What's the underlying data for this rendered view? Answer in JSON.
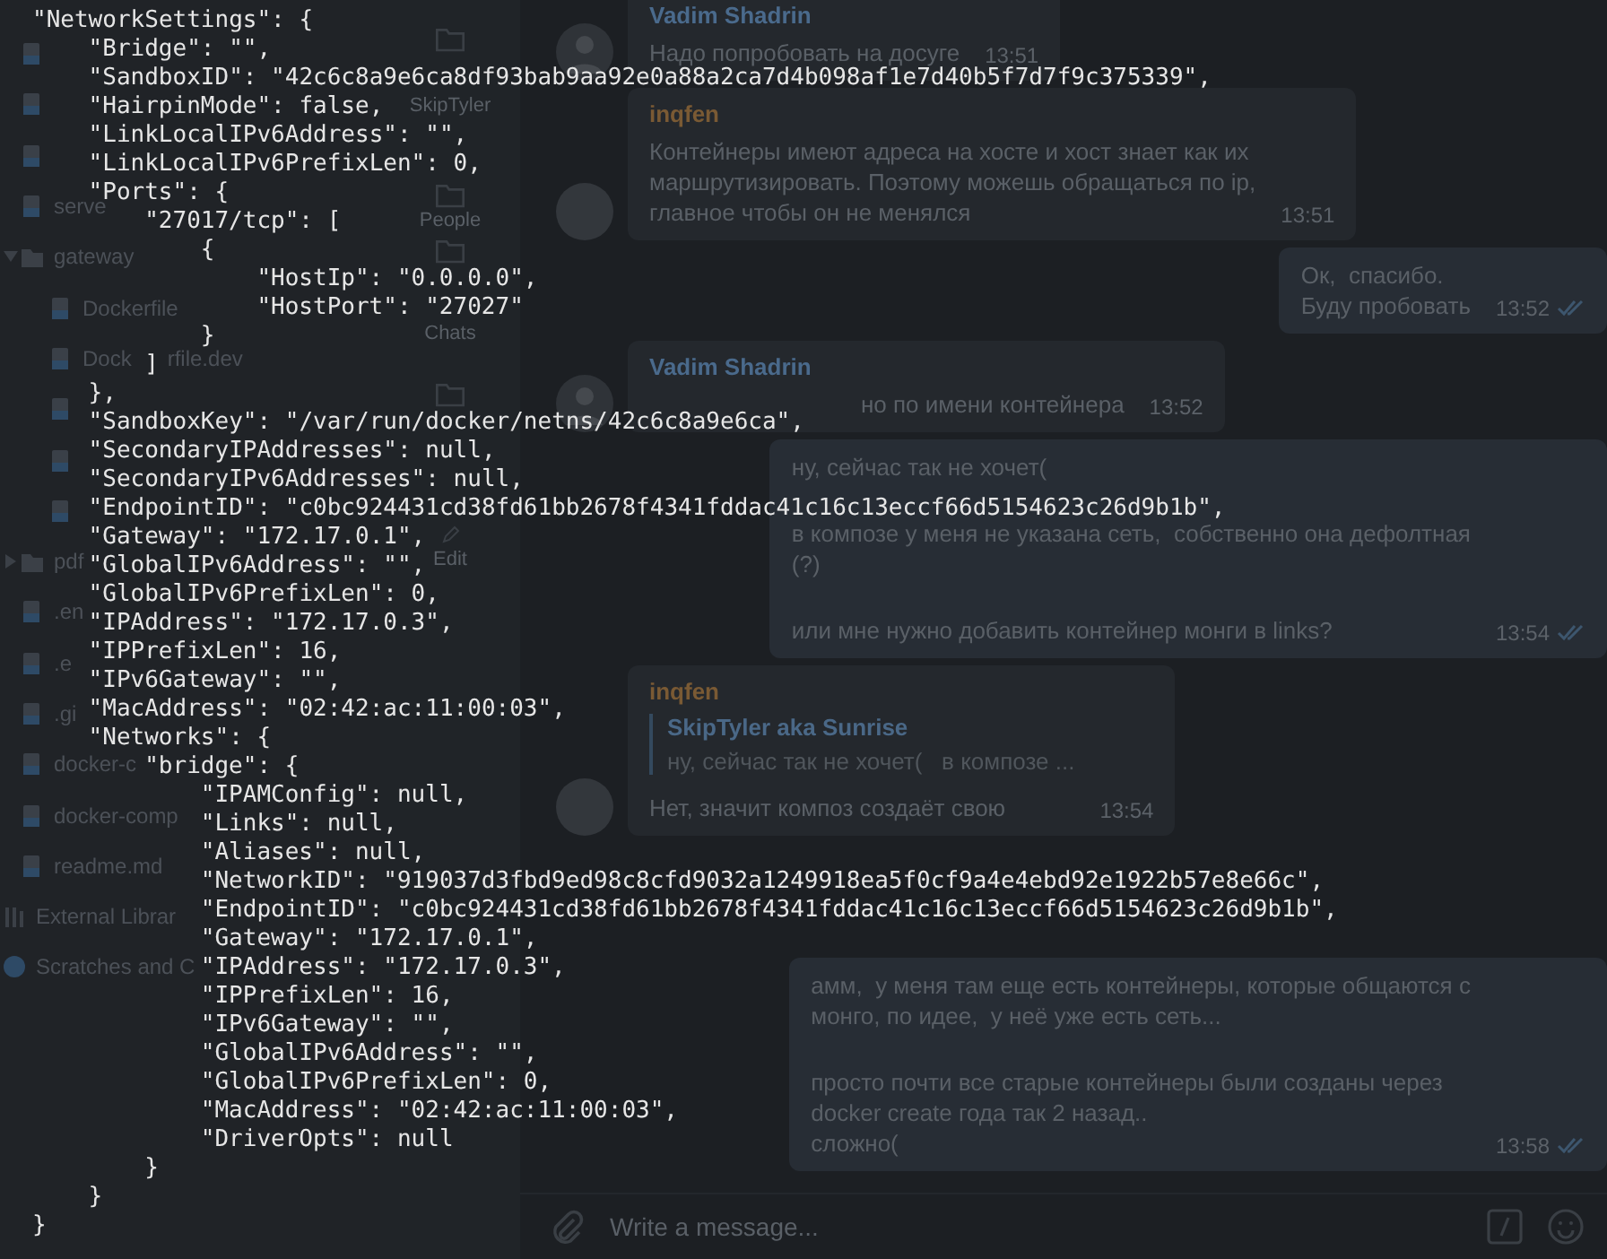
{
  "project_tree": {
    "items": [
      {
        "kind": "file"
      },
      {
        "kind": "file"
      },
      {
        "kind": "file"
      },
      {
        "kind": "file",
        "label": "serve"
      },
      {
        "kind": "folder",
        "label": "gateway",
        "expanded": true,
        "children": [
          {
            "kind": "file",
            "label": "Dockerfile"
          },
          {
            "kind": "file",
            "label_parts": [
              "Dock",
              "rfile.dev"
            ]
          },
          {
            "kind": "file"
          },
          {
            "kind": "file"
          },
          {
            "kind": "file"
          }
        ]
      },
      {
        "kind": "folder",
        "label": "pdf",
        "expanded": false
      },
      {
        "kind": "file",
        "label": ".en"
      },
      {
        "kind": "file",
        "label": ".e"
      },
      {
        "kind": "file",
        "label": ".gi"
      },
      {
        "kind": "file",
        "label": "docker-c"
      },
      {
        "kind": "file",
        "label": "docker-comp"
      },
      {
        "kind": "file",
        "label": "readme.md"
      },
      {
        "kind": "library",
        "label": "External Librar"
      },
      {
        "kind": "scratch",
        "label": "Scratches and C"
      }
    ]
  },
  "folders": [
    {
      "kind": "folder",
      "label": "SkipTyler"
    },
    {
      "kind": "folder",
      "label": "People"
    },
    {
      "kind": "folder",
      "label": "Chats"
    },
    {
      "kind": "folder"
    },
    {
      "kind": "edit",
      "label": "Edit"
    }
  ],
  "messages": [
    {
      "kind": "incoming",
      "sender": "Vadim Shadrin",
      "color": "#4a6a8c",
      "avatar": {
        "kind": "figure"
      },
      "paragraphs": [
        "Надо попробовать на досуге"
      ],
      "time": "13:51"
    },
    {
      "kind": "incoming",
      "sender": "inqfen",
      "color": "#7a5a34",
      "avatar": {
        "kind": "plain"
      },
      "paragraphs": [
        "Контейнеры имеют адреса на хосте и хост знает как их\nмаршрутизировать. Поэтому можешь обращаться по ip,\nглавное чтобы он не менялся"
      ],
      "time": "13:51"
    },
    {
      "kind": "outgoing",
      "paragraphs": [
        "Ок,  спасибо.\nБуду пробовать"
      ],
      "time": "13:52",
      "read": true
    },
    {
      "kind": "incoming",
      "sender": "Vadim Shadrin",
      "color": "#4a6a8c",
      "avatar": {
        "kind": "figure"
      },
      "paragraphs": [
        "но по имени контейнера"
      ],
      "time": "13:52"
    },
    {
      "kind": "outgoing",
      "paragraphs": [
        "ну, сейчас так не хочет(",
        "в композе у меня не указана сеть,  собственно она дефолтная\n(?)",
        "или мне нужно добавить контейнер монги в links?"
      ],
      "time": "13:54",
      "read": true
    },
    {
      "kind": "incoming",
      "sender": "inqfen",
      "color": "#7a5a34",
      "avatar": {
        "kind": "plain"
      },
      "reply": {
        "sender": "SkipTyler aka Sunrise",
        "text": "ну, сейчас так не хочет(   в композе ..."
      },
      "paragraphs": [
        "Нет, значит композ создаёт свою"
      ],
      "time": "13:54"
    },
    {
      "kind": "outgoing",
      "paragraphs": [
        "амм,  у меня там еще есть контейнеры, которые общаются с\nмонго, по идее,  у неё уже есть сеть...",
        "просто почти все старые контейнеры были созданы через\ndocker create года так 2 назад..\nсложно("
      ],
      "time": "13:58",
      "read": true
    }
  ],
  "composer": {
    "placeholder": "Write a message..."
  },
  "terminal": {
    "lines": [
      {
        "text": "\"NetworkSettings\": {",
        "close": "}",
        "children": [
          {
            "text": "\"Bridge\": \"\","
          },
          {
            "text": "\"SandboxID\": \"42c6c8a9e6ca8df93bab9aa92e0a88a2ca7d4b098af1e7d40b5f7d7f9c375339\","
          },
          {
            "text": "\"HairpinMode\": false,"
          },
          {
            "text": "\"LinkLocalIPv6Address\": \"\","
          },
          {
            "text": "\"LinkLocalIPv6PrefixLen\": 0,"
          },
          {
            "text": "\"Ports\": {",
            "close": "},",
            "children": [
              {
                "text": "\"27017/tcp\": [",
                "close": "]",
                "children": [
                  {
                    "text": "{",
                    "close": "}",
                    "children": [
                      {
                        "text": "\"HostIp\": \"0.0.0.0\","
                      },
                      {
                        "text": "\"HostPort\": \"27027\""
                      }
                    ]
                  }
                ]
              }
            ]
          },
          {
            "text": "\"SandboxKey\": \"/var/run/docker/netns/42c6c8a9e6ca\","
          },
          {
            "text": "\"SecondaryIPAddresses\": null,"
          },
          {
            "text": "\"SecondaryIPv6Addresses\": null,"
          },
          {
            "text": "\"EndpointID\": \"c0bc924431cd38fd61bb2678f4341fddac41c16c13eccf66d5154623c26d9b1b\","
          },
          {
            "text": "\"Gateway\": \"172.17.0.1\","
          },
          {
            "text": "\"GlobalIPv6Address\": \"\","
          },
          {
            "text": "\"GlobalIPv6PrefixLen\": 0,"
          },
          {
            "text": "\"IPAddress\": \"172.17.0.3\","
          },
          {
            "text": "\"IPPrefixLen\": 16,"
          },
          {
            "text": "\"IPv6Gateway\": \"\","
          },
          {
            "text": "\"MacAddress\": \"02:42:ac:11:00:03\","
          },
          {
            "text": "\"Networks\": {",
            "close": "}",
            "children": [
              {
                "text": "\"bridge\": {",
                "close": "}",
                "children": [
                  {
                    "text": "\"IPAMConfig\": null,"
                  },
                  {
                    "text": "\"Links\": null,"
                  },
                  {
                    "text": "\"Aliases\": null,"
                  },
                  {
                    "text": "\"NetworkID\": \"919037d3fbd9ed98c8cfd9032a1249918ea5f0cf9a4e4ebd92e1922b57e8e66c\","
                  },
                  {
                    "text": "\"EndpointID\": \"c0bc924431cd38fd61bb2678f4341fddac41c16c13eccf66d5154623c26d9b1b\","
                  },
                  {
                    "text": "\"Gateway\": \"172.17.0.1\","
                  },
                  {
                    "text": "\"IPAddress\": \"172.17.0.3\","
                  },
                  {
                    "text": "\"IPPrefixLen\": 16,"
                  },
                  {
                    "text": "\"IPv6Gateway\": \"\","
                  },
                  {
                    "text": "\"GlobalIPv6Address\": \"\","
                  },
                  {
                    "text": "\"GlobalIPv6PrefixLen\": 0,"
                  },
                  {
                    "text": "\"MacAddress\": \"02:42:ac:11:00:03\","
                  },
                  {
                    "text": "\"DriverOpts\": null"
                  }
                ]
              }
            ]
          }
        ]
      }
    ]
  }
}
